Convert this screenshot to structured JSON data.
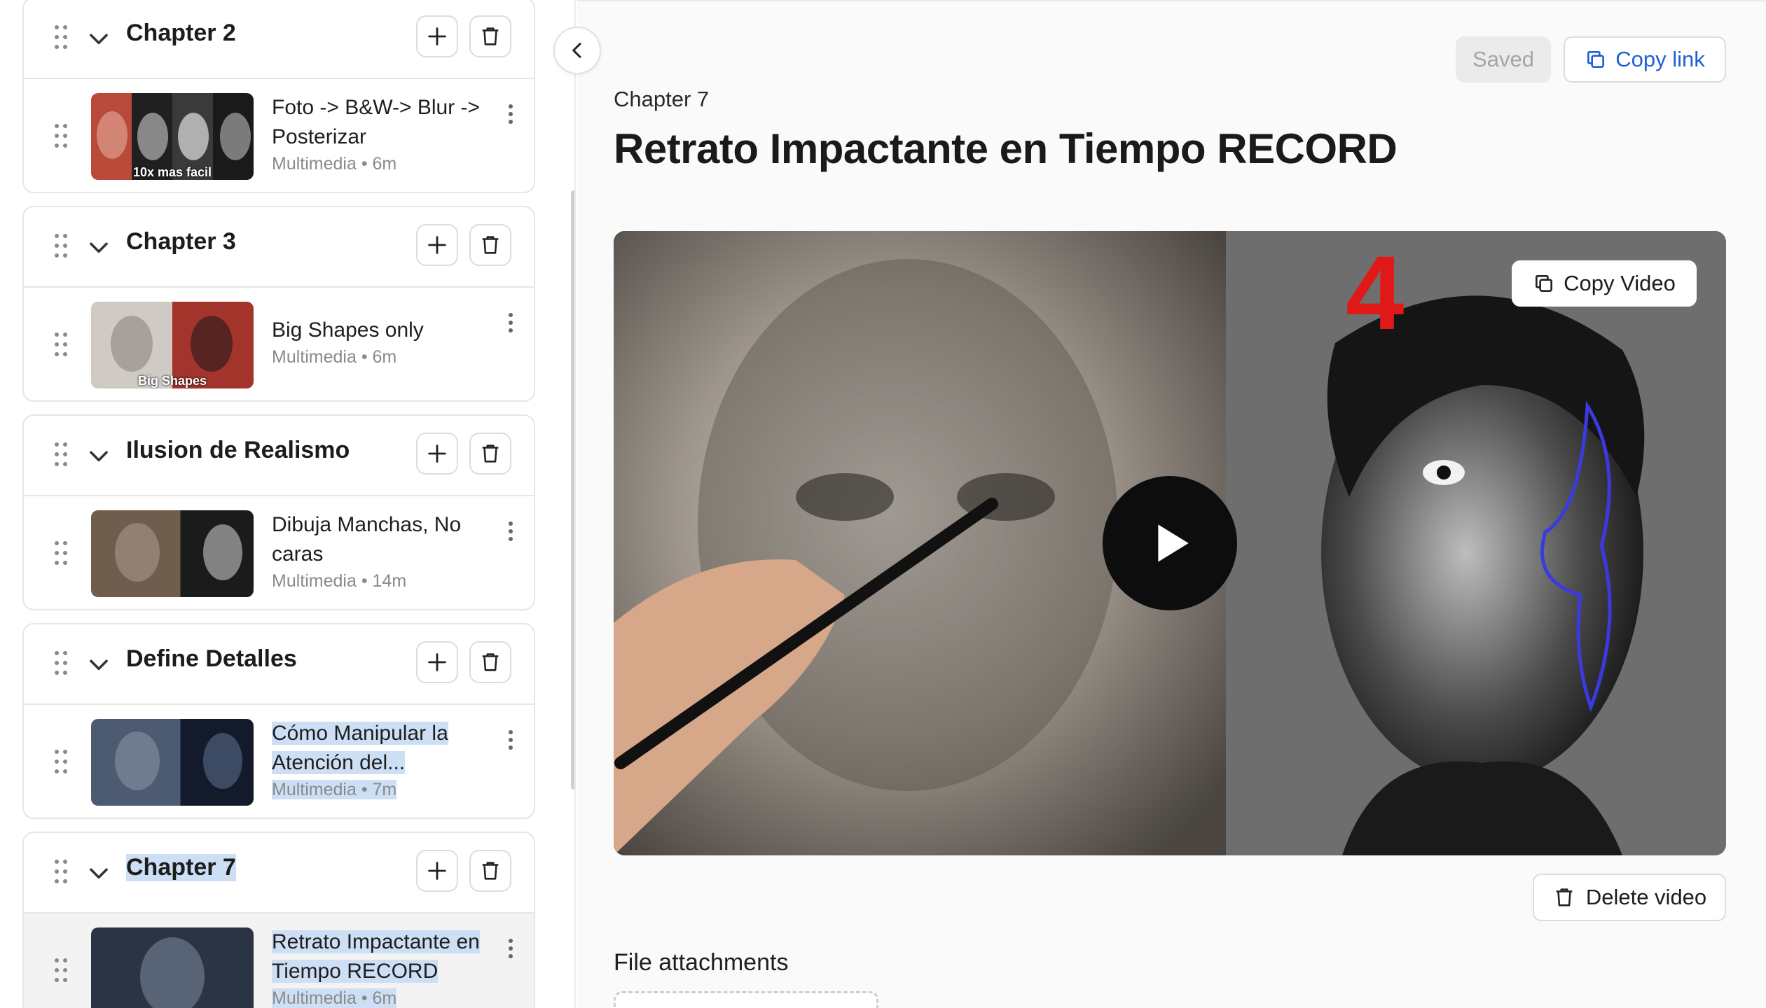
{
  "sidebar": {
    "chapters": [
      {
        "title": "Chapter 2",
        "lesson": {
          "title": "Foto -> B&W-> Blur -> Posterizar",
          "meta": "Multimedia • 6m",
          "thumb_caption": "10x mas facil"
        }
      },
      {
        "title": "Chapter 3",
        "lesson": {
          "title": "Big Shapes only",
          "meta": "Multimedia • 6m",
          "thumb_caption": "Big Shapes"
        }
      },
      {
        "title": "Ilusion de Realismo",
        "lesson": {
          "title": "Dibuja Manchas, No caras",
          "meta": "Multimedia • 14m",
          "thumb_caption": ""
        }
      },
      {
        "title": "Define Detalles",
        "lesson": {
          "title": "Cómo Manipular la Atención del...",
          "meta": "Multimedia • 7m",
          "thumb_caption": ""
        }
      },
      {
        "title": "Chapter 7",
        "lesson": {
          "title": "Retrato Impactante en Tiempo RECORD",
          "meta": "Multimedia • 6m",
          "thumb_caption": ""
        }
      }
    ]
  },
  "header": {
    "saved_label": "Saved",
    "copy_link_label": "Copy link"
  },
  "main": {
    "chapter_label": "Chapter 7",
    "title": "Retrato Impactante en Tiempo RECORD",
    "copy_video_label": "Copy Video",
    "delete_video_label": "Delete video",
    "attachments_label": "File attachments",
    "video_overlay_number": "4"
  },
  "colors": {
    "accent": "#1f5fd6",
    "selection": "#cddff5",
    "border": "#e6e6e6"
  }
}
